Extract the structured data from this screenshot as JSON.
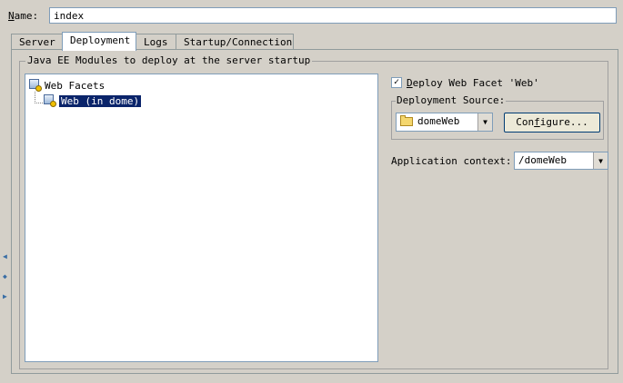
{
  "name_field": {
    "label_prefix": "N",
    "label_rest": "ame:",
    "value": "index"
  },
  "tabs": [
    {
      "label": "Server",
      "active": false
    },
    {
      "label": "Deployment",
      "active": true
    },
    {
      "label": "Logs",
      "active": false
    },
    {
      "label": "Startup/Connection",
      "active": false
    }
  ],
  "modules_group": {
    "title": "Java EE Modules to deploy at the server startup",
    "tree": {
      "root_label": "Web Facets",
      "child_label": "Web (in dome)"
    }
  },
  "deploy_checkbox": {
    "checked": true,
    "label_prefix": "D",
    "label_rest": "eploy Web Facet 'Web'"
  },
  "deployment_source": {
    "title": "Deployment Source:",
    "selected": "domeWeb",
    "configure_prefix": "Con",
    "configure_mnemonic": "f",
    "configure_rest": "igure..."
  },
  "application_context": {
    "label": "Application context:",
    "value": "/domeWeb"
  },
  "icons": {
    "facet": "web-facet-icon",
    "folder": "folder-icon",
    "dropdown": "chevron-down-icon"
  }
}
